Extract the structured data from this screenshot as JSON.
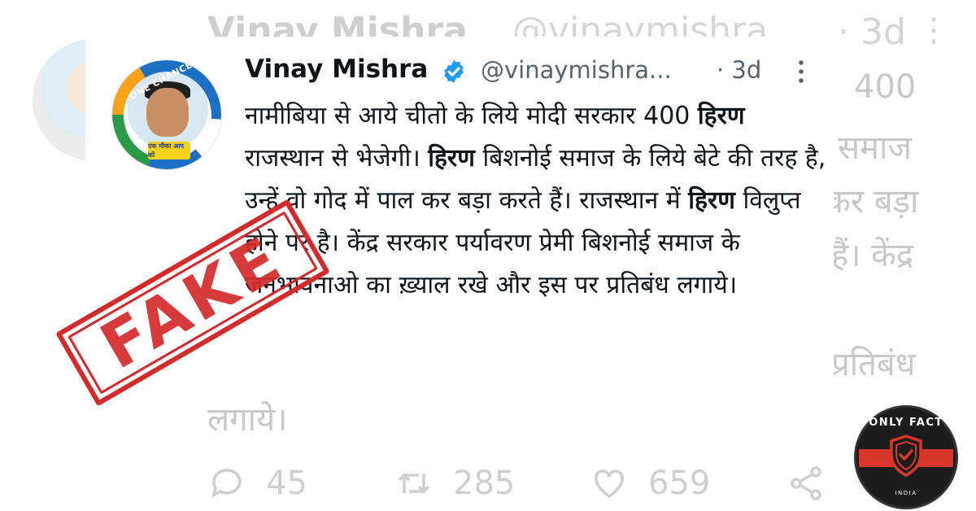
{
  "tweet": {
    "author_name": "Vinay Mishra",
    "handle": "@vinaymishra...",
    "timestamp": "· 3d",
    "more_icon": "more-vertical-icon",
    "verified_icon": "verified-badge-icon",
    "avatar": {
      "arc_text": "ONE CHANCE TO AAP",
      "badge_text": "एक मौका आप को"
    },
    "body_segments": [
      {
        "text": "नामीबिया से आये चीतो के लिये मोदी सरकार 400 ",
        "bold": false
      },
      {
        "text": "हिरण",
        "bold": true
      },
      {
        "text": " राजस्थान से भेजेगी। ",
        "bold": false
      },
      {
        "text": "हिरण",
        "bold": true
      },
      {
        "text": " बिशनोई समाज के लिये बेटे की तरह है, उन्हें वो गोद में पाल कर बड़ा करते हैं। राजस्थान में ",
        "bold": false
      },
      {
        "text": "हिरण",
        "bold": true
      },
      {
        "text": " विलुप्त होने पर है। केंद्र सरकार पर्यावरण प्रेमी बिशनोई समाज के जनभावनाओ का ख़्याल रखे और इस पर प्रतिबंध लगाये।",
        "bold": false
      }
    ]
  },
  "background": {
    "author_name": "Vinay Mishra",
    "handle": "@vinaymishra",
    "timestamp": "· 3d",
    "fragments": [
      "400",
      "समाज",
      "कर बड़ा",
      "हैं। केंद्र",
      "प्रतिबंध",
      "लगाये।"
    ],
    "actions": [
      {
        "icon": "reply-icon",
        "count": "45"
      },
      {
        "icon": "retweet-icon",
        "count": "285"
      },
      {
        "icon": "like-icon",
        "count": "659"
      },
      {
        "icon": "share-icon",
        "count": ""
      }
    ]
  },
  "stamp": {
    "text": "FAKE",
    "color": "#d42a2a"
  },
  "logo": {
    "top_text": "ONLY FACT",
    "bottom_text": "INDIA",
    "accent": "#d9362b"
  },
  "colors": {
    "verified": "#1d9bf0",
    "text": "#0f1419",
    "muted": "#536471"
  }
}
